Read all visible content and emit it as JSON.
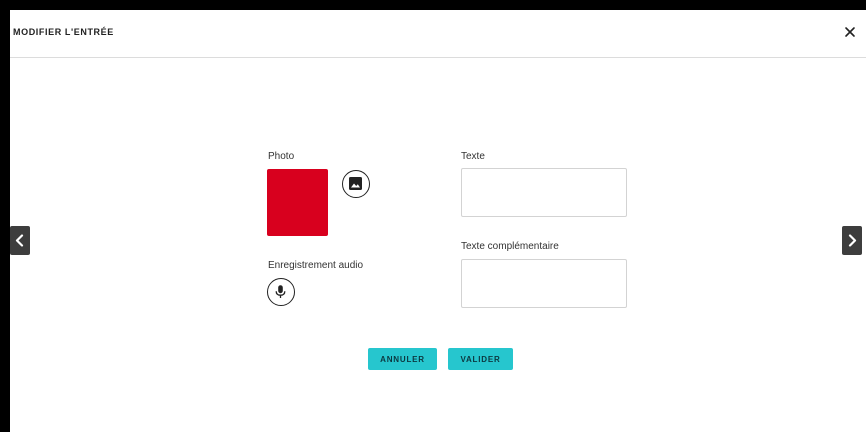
{
  "dialog": {
    "title": "MODIFIER L'ENTRÉE",
    "close_icon": "close-icon"
  },
  "photo": {
    "label": "Photo",
    "preview_color": "#d8001e",
    "picker_icon": "image-icon"
  },
  "audio": {
    "label": "Enregistrement audio",
    "record_icon": "microphone-icon"
  },
  "text": {
    "label": "Texte",
    "value": ""
  },
  "complementary_text": {
    "label": "Texte complémentaire",
    "value": ""
  },
  "actions": {
    "cancel_label": "ANNULER",
    "confirm_label": "VALIDER",
    "accent_color": "#26c6ce"
  },
  "navigation": {
    "prev_icon": "chevron-left-icon",
    "next_icon": "chevron-right-icon"
  }
}
